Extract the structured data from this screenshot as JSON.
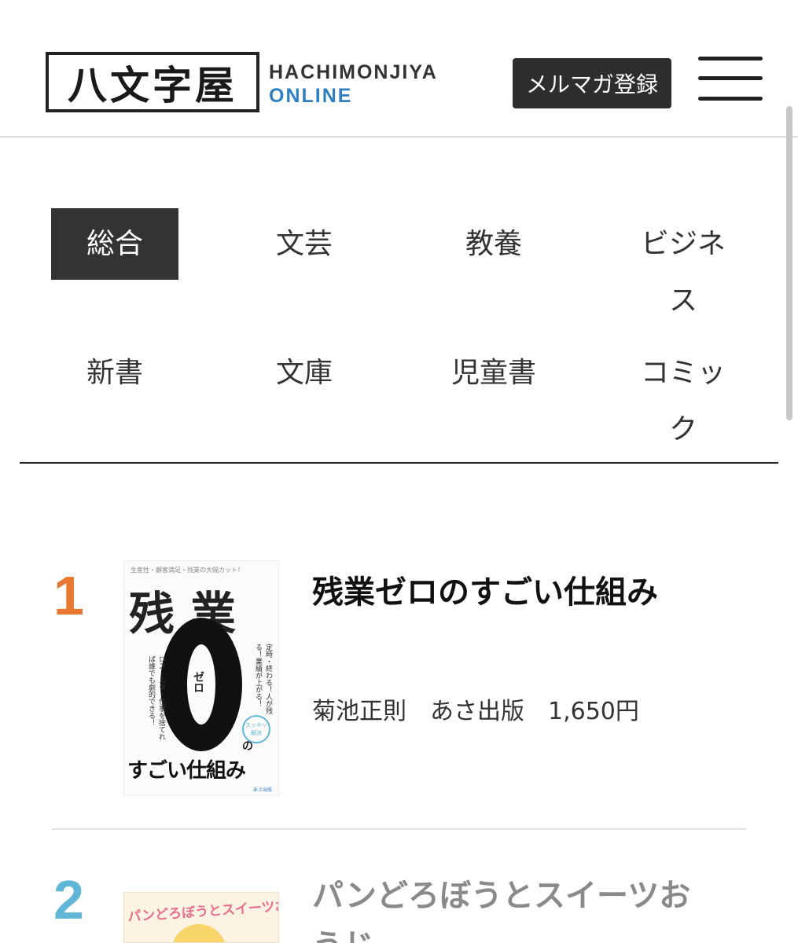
{
  "header": {
    "logo": "八文字屋",
    "logo_sub1": "HACHIMONJIYA",
    "logo_sub2": "ONLINE",
    "mailmag_label": "メルマガ登録",
    "colors": {
      "accent_blue": "#2f7fc1",
      "dark": "#2e2e2e"
    }
  },
  "tabs": [
    {
      "label": "総合",
      "active": true
    },
    {
      "label": "文芸",
      "active": false
    },
    {
      "label": "教養",
      "active": false
    },
    {
      "label": "ビジネス",
      "active": false
    },
    {
      "label": "新書",
      "active": false
    },
    {
      "label": "文庫",
      "active": false
    },
    {
      "label": "児童書",
      "active": false
    },
    {
      "label": "コミック",
      "active": false
    }
  ],
  "ranking": [
    {
      "rank": "1",
      "title": "残業ゼロのすごい仕組み",
      "meta": "菊池正則　あさ出版　1,650円",
      "rank_color": "#e8782f",
      "cover": {
        "top_text": "生産性・顧客満足・残業の大幅カット！",
        "big": "残業",
        "zero_label": "ゼロ",
        "no": "の",
        "side_left": "ロス・ムダ・仕事を捨てれば誰でも劇的できる！",
        "side_right": "定時・終わる！人が残る！業績が上がる！",
        "badge": "スッキリ解決",
        "bottom": "すごい仕組み",
        "publisher": "あさ出版"
      }
    },
    {
      "rank": "2",
      "title": "パンどろぼうとスイーツおうじ",
      "rank_color": "#5fb6d6",
      "cover": {
        "title": "パンどろぼうとスイーツおうじ"
      }
    }
  ]
}
